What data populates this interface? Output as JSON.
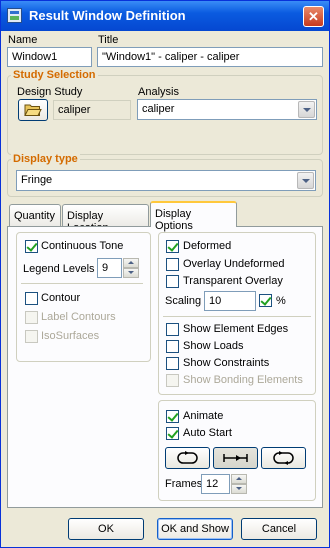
{
  "window": {
    "title": "Result Window Definition"
  },
  "name": {
    "label": "Name",
    "value": "Window1"
  },
  "title_field": {
    "label": "Title",
    "value": "\"Window1\" - caliper - caliper"
  },
  "study_selection": {
    "group_title": "Study Selection",
    "design_study_label": "Design Study",
    "design_study_value": "caliper",
    "analysis_label": "Analysis",
    "analysis_value": "caliper"
  },
  "display_type": {
    "group_title": "Display type",
    "value": "Fringe"
  },
  "tabs": [
    {
      "label": "Quantity"
    },
    {
      "label": "Display Location"
    },
    {
      "label": "Display Options"
    }
  ],
  "left": {
    "continuous_tone": "Continuous Tone",
    "legend_levels_label": "Legend Levels",
    "legend_levels_value": "9",
    "contour": "Contour",
    "label_contours": "Label Contours",
    "isosurfaces": "IsoSurfaces"
  },
  "right": {
    "deformed": "Deformed",
    "overlay_undeformed": "Overlay Undeformed",
    "transparent_overlay": "Transparent Overlay",
    "scaling_label": "Scaling",
    "scaling_value": "10",
    "percent": "%",
    "show_element_edges": "Show Element Edges",
    "show_loads": "Show Loads",
    "show_constraints": "Show Constraints",
    "show_bonding_elements": "Show Bonding Elements"
  },
  "animation": {
    "animate": "Animate",
    "auto_start": "Auto Start",
    "frames_label": "Frames",
    "frames_value": "12"
  },
  "buttons": {
    "ok": "OK",
    "ok_and_show": "OK and Show",
    "cancel": "Cancel"
  },
  "colors": {
    "accent": "#d46b00",
    "title_bar": "#0a5be0",
    "check": "#21a121"
  },
  "icons": [
    "window-icon",
    "close-icon",
    "folder-open-icon",
    "dropdown-arrow-icon",
    "spin-up-icon",
    "spin-down-icon",
    "loop-play-icon",
    "forward-play-icon",
    "back-forth-play-icon"
  ]
}
